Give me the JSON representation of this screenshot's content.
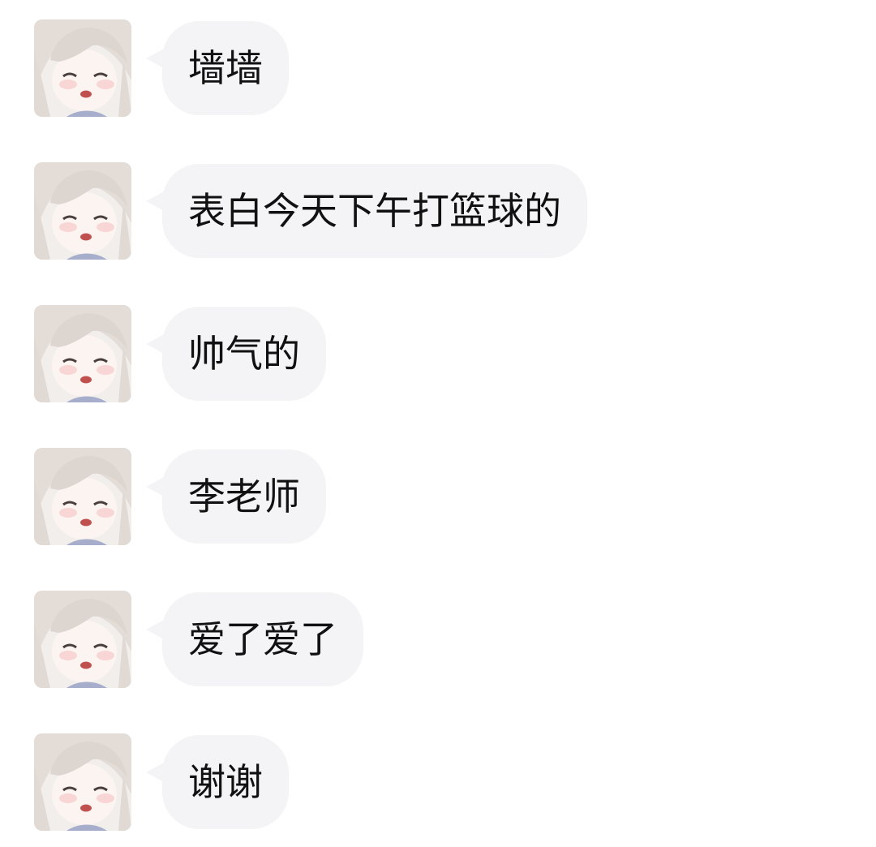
{
  "messages": [
    {
      "text": "墙墙"
    },
    {
      "text": "表白今天下午打篮球的"
    },
    {
      "text": "帅气的"
    },
    {
      "text": "李老师"
    },
    {
      "text": "爱了爱了"
    },
    {
      "text": "谢谢"
    }
  ],
  "colors": {
    "background": "#ffffff",
    "bubble": "#f4f4f6",
    "text": "#111111"
  },
  "icons": {
    "avatar": "anime-girl-avatar-icon"
  }
}
